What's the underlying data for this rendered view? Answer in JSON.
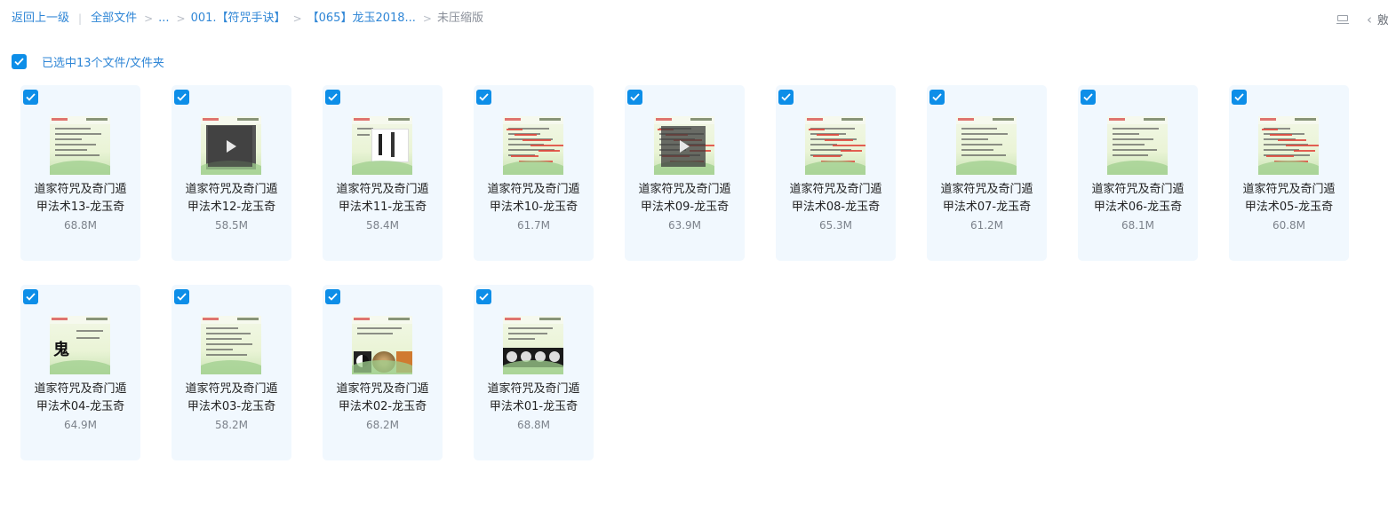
{
  "breadcrumb": {
    "back": "返回上一级",
    "all_files": "全部文件",
    "ellipsis": "...",
    "folder1": "001.【符咒手诀】",
    "folder2": "【065】龙玉2018...",
    "current": "未压缩版"
  },
  "topbar": {
    "list_icon": "list-view-icon",
    "back_icon": "chevron-left-icon",
    "cut_text": "敫"
  },
  "selection": {
    "label": "已选中13个文件/文件夹",
    "checked": true
  },
  "colors": {
    "accent": "#0d8ee8",
    "link": "#2f86d6",
    "card_bg": "#f1f8fe"
  },
  "files": [
    {
      "line1": "道家符咒及奇门遁",
      "line2": "甲法术13-龙玉奇",
      "size": "68.8M",
      "video": false,
      "variant": "plain"
    },
    {
      "line1": "道家符咒及奇门遁",
      "line2": "甲法术12-龙玉奇",
      "size": "58.5M",
      "video": true,
      "variant": "dark"
    },
    {
      "line1": "道家符咒及奇门遁",
      "line2": "甲法术11-龙玉奇",
      "size": "58.4M",
      "video": false,
      "variant": "script"
    },
    {
      "line1": "道家符咒及奇门遁",
      "line2": "甲法术10-龙玉奇",
      "size": "61.7M",
      "video": false,
      "variant": "red"
    },
    {
      "line1": "道家符咒及奇门遁",
      "line2": "甲法术09-龙玉奇",
      "size": "63.9M",
      "video": true,
      "variant": "red"
    },
    {
      "line1": "道家符咒及奇门遁",
      "line2": "甲法术08-龙玉奇",
      "size": "65.3M",
      "video": false,
      "variant": "red"
    },
    {
      "line1": "道家符咒及奇门遁",
      "line2": "甲法术07-龙玉奇",
      "size": "61.2M",
      "video": false,
      "variant": "plain"
    },
    {
      "line1": "道家符咒及奇门遁",
      "line2": "甲法术06-龙玉奇",
      "size": "68.1M",
      "video": false,
      "variant": "plain"
    },
    {
      "line1": "道家符咒及奇门遁",
      "line2": "甲法术05-龙玉奇",
      "size": "60.8M",
      "video": false,
      "variant": "red"
    },
    {
      "line1": "道家符咒及奇门遁",
      "line2": "甲法术04-龙玉奇",
      "size": "64.9M",
      "video": false,
      "variant": "glyph"
    },
    {
      "line1": "道家符咒及奇门遁",
      "line2": "甲法术03-龙玉奇",
      "size": "58.2M",
      "video": false,
      "variant": "plain"
    },
    {
      "line1": "道家符咒及奇门遁",
      "line2": "甲法术02-龙玉奇",
      "size": "68.2M",
      "video": false,
      "variant": "taiji"
    },
    {
      "line1": "道家符咒及奇门遁",
      "line2": "甲法术01-龙玉奇",
      "size": "68.8M",
      "video": false,
      "variant": "stones"
    }
  ]
}
